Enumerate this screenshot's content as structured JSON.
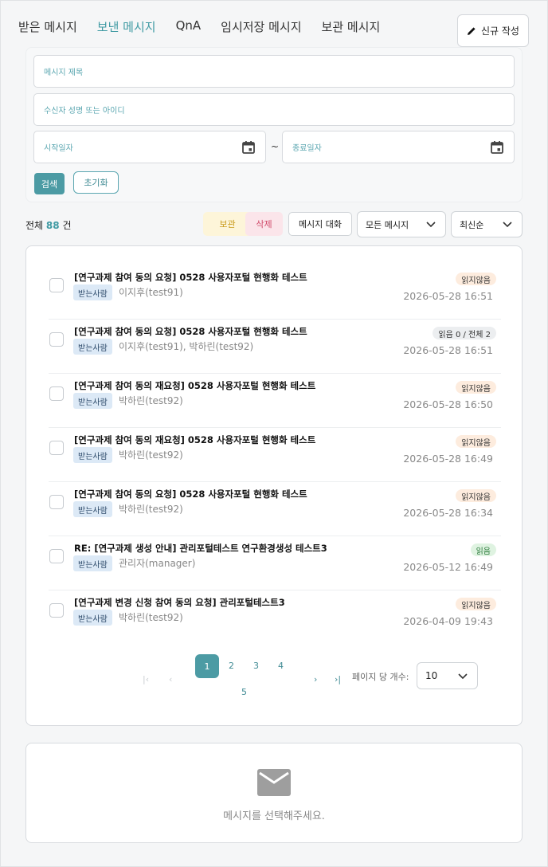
{
  "tabs": [
    {
      "label": "받은 메시지",
      "active": false
    },
    {
      "label": "보낸 메시지",
      "active": true
    },
    {
      "label": "QnA",
      "active": false
    },
    {
      "label": "임시저장 메시지",
      "active": false
    },
    {
      "label": "보관 메시지",
      "active": false
    }
  ],
  "new_button": {
    "label": "신규 작성",
    "icon": "pencil-icon"
  },
  "search": {
    "subject_placeholder": "메시지 제목",
    "recipient_placeholder": "수신자 성명 또는 아이디",
    "start_placeholder": "시작일자",
    "end_placeholder": "종료일자",
    "range_sep": "~",
    "search_label": "검색",
    "reset_label": "초기화"
  },
  "summary": {
    "prefix": "전체",
    "count": "88",
    "suffix": "건"
  },
  "toolbar": {
    "archive_label": "보관",
    "delete_label": "삭제",
    "conversation_label": "메시지 대화",
    "filter_value": "모든 메시지",
    "sort_value": "최신순"
  },
  "messages": [
    {
      "subject": "[연구과제 참여 동의 요청] 0528 사용자포털 현행화 테스트",
      "recipient_label": "받는사람",
      "recipient": "이지후(test91)",
      "status": "읽지않음",
      "status_type": "unread",
      "date": "2026-05-28 16:51"
    },
    {
      "subject": "[연구과제 참여 동의 요청] 0528 사용자포털 현행화 테스트",
      "recipient_label": "받는사람",
      "recipient": "이지후(test91), 박하린(test92)",
      "status": "읽음 0 / 전체 2",
      "status_type": "partial",
      "date": "2026-05-28 16:51"
    },
    {
      "subject": "[연구과제 참여 동의 재요청] 0528 사용자포털 현행화 테스트",
      "recipient_label": "받는사람",
      "recipient": "박하린(test92)",
      "status": "읽지않음",
      "status_type": "unread",
      "date": "2026-05-28 16:50"
    },
    {
      "subject": "[연구과제 참여 동의 재요청] 0528 사용자포털 현행화 테스트",
      "recipient_label": "받는사람",
      "recipient": "박하린(test92)",
      "status": "읽지않음",
      "status_type": "unread",
      "date": "2026-05-28 16:49"
    },
    {
      "subject": "[연구과제 참여 동의 요청] 0528 사용자포털 현행화 테스트",
      "recipient_label": "받는사람",
      "recipient": "박하린(test92)",
      "status": "읽지않음",
      "status_type": "unread",
      "date": "2026-05-28 16:34"
    },
    {
      "subject": "RE: [연구과제 생성 안내] 관리포털테스트 연구환경생성 테스트3",
      "recipient_label": "받는사람",
      "recipient": "관리자(manager)",
      "status": "읽음",
      "status_type": "read",
      "date": "2026-05-12 16:49"
    },
    {
      "subject": "[연구과제 변경 신청 참여 동의 요청] 관리포털테스트3",
      "recipient_label": "받는사람",
      "recipient": "박하린(test92)",
      "status": "읽지않음",
      "status_type": "unread",
      "date": "2026-04-09 19:43"
    }
  ],
  "pagination": {
    "first": "|‹",
    "prev": "‹",
    "current": "1",
    "pages": [
      "2",
      "3",
      "4",
      "5"
    ],
    "next": "›",
    "last": "›|",
    "per_page_label": "페이지 당 개수:",
    "per_page_value": "10"
  },
  "detail": {
    "empty_message": "메시지를 선택해주세요.",
    "icon": "mail-icon"
  },
  "colors": {
    "accent": "#4c9ba4",
    "accent_text": "#3f9aa3",
    "unread_bg": "#fdecde",
    "read_bg": "#dff3e1",
    "archive_bg": "#fdf5d9",
    "delete_bg": "#fbe5ea"
  }
}
